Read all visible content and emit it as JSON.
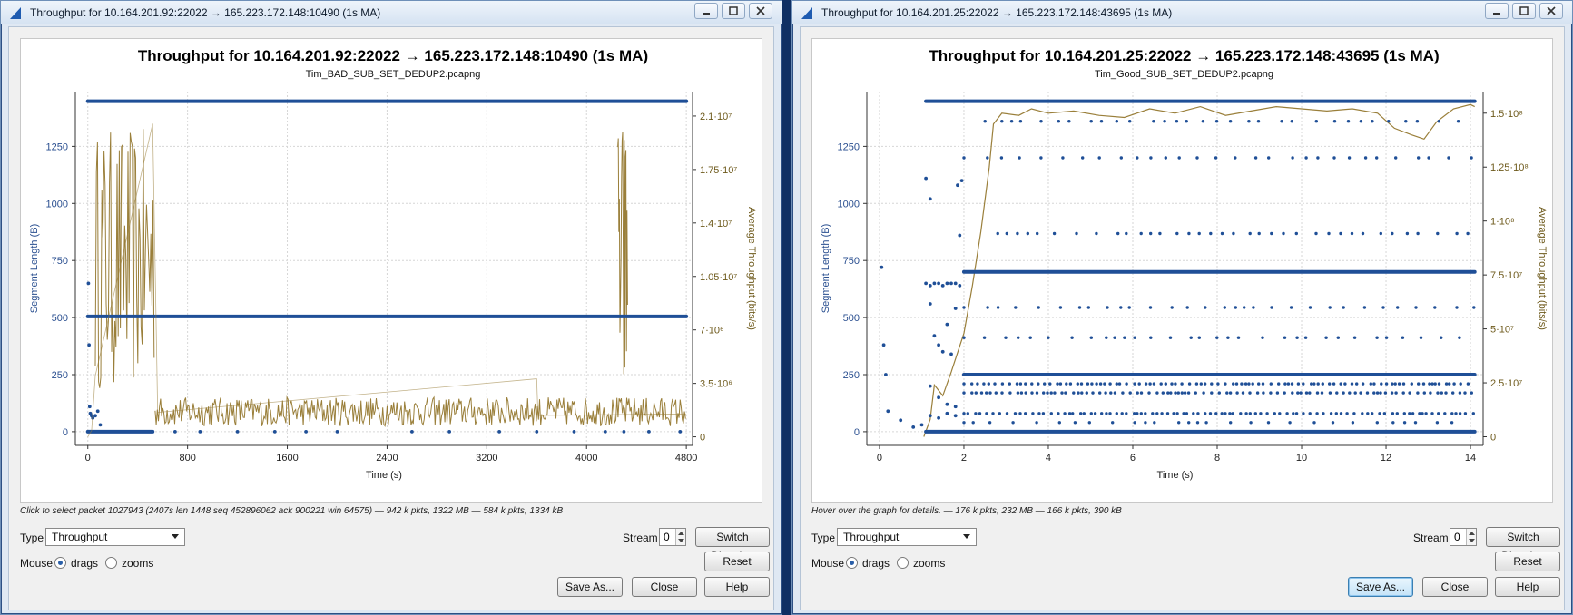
{
  "colors": {
    "segment": "#1f4f97",
    "throughput": "#9a7f3a",
    "grid": "#d6d6d6",
    "desktop": "#0f2f63"
  },
  "windows": [
    {
      "title": "Throughput for 10.164.201.92:22022 → 165.223.172.148:10490 (1s MA)",
      "hint": "Click to select packet 1027943 (2407s len 1448 seq 452896062 ack 900221 win 64575) — 942 k pkts, 1322 MB — 584 k pkts, 1334 kB",
      "type_label": "Type",
      "type_value": "Throughput",
      "stream_label": "Stream",
      "stream_value": "0",
      "switch_direction": "Switch Direction",
      "mouse_label": "Mouse",
      "drags": "drags",
      "zooms": "zooms",
      "reset": "Reset",
      "save_as": "Save As...",
      "close": "Close",
      "help": "Help",
      "save_is_default": false
    },
    {
      "title": "Throughput for 10.164.201.25:22022 → 165.223.172.148:43695 (1s MA)",
      "hint": "Hover over the graph for details. — 176 k pkts, 232 MB — 166 k pkts, 390 kB",
      "type_label": "Type",
      "type_value": "Throughput",
      "stream_label": "Stream",
      "stream_value": "0",
      "switch_direction": "Switch Direction",
      "mouse_label": "Mouse",
      "drags": "drags",
      "zooms": "zooms",
      "reset": "Reset",
      "save_as": "Save As...",
      "close": "Close",
      "help": "Help",
      "save_is_default": true
    }
  ],
  "chart_data": [
    {
      "type": "scatter",
      "title": "Throughput for 10.164.201.92:22022 → 165.223.172.148:10490 (1s MA)",
      "subtitle": "Tim_BAD_SUB_SET_DEDUP2.pcapng",
      "xlabel": "Time (s)",
      "ylabel": "Segment Length (B)",
      "y2label": "Average Throughput (bits/s)",
      "xlim": [
        -100,
        4850
      ],
      "ylim": [
        -60,
        1490
      ],
      "y2lim": [
        -560000,
        22600000
      ],
      "xticks": [
        0,
        800,
        1600,
        2400,
        3200,
        4000,
        4800
      ],
      "xtick_labels": [
        "0",
        "800",
        "1600",
        "2400",
        "3200",
        "4000",
        "4800"
      ],
      "yticks": [
        0,
        250,
        500,
        750,
        1000,
        1250
      ],
      "ytick_labels": [
        "0",
        "250",
        "500",
        "750",
        "1000",
        "1250"
      ],
      "y2ticks": [
        0,
        3500000,
        7000000,
        10500000,
        14000000,
        17500000,
        21000000
      ],
      "y2tick_labels": [
        "0",
        "3.5·10⁶",
        "7·10⁶",
        "1.05·10⁷",
        "1.4·10⁷",
        "1.75·10⁷",
        "2.1·10⁷"
      ],
      "grid": true,
      "series": [
        {
          "name": "Segment Length",
          "axis": "left",
          "style": "points",
          "bands": [
            {
              "y": 1448,
              "x0": 0,
              "x1": 4800
            },
            {
              "y": 505,
              "x0": 0,
              "x1": 4800
            },
            {
              "y": 0,
              "x0": 0,
              "x1": 520
            }
          ],
          "points": [
            [
              5,
              650
            ],
            [
              10,
              380
            ],
            [
              15,
              110
            ],
            [
              20,
              80
            ],
            [
              30,
              70
            ],
            [
              40,
              60
            ],
            [
              60,
              70
            ],
            [
              80,
              90
            ],
            [
              100,
              30
            ],
            [
              700,
              0
            ],
            [
              900,
              0
            ],
            [
              1200,
              0
            ],
            [
              1500,
              0
            ],
            [
              1750,
              0
            ],
            [
              2000,
              0
            ],
            [
              2407,
              1448
            ],
            [
              2600,
              0
            ],
            [
              2900,
              0
            ],
            [
              3300,
              0
            ],
            [
              3600,
              0
            ],
            [
              3900,
              0
            ],
            [
              4150,
              0
            ],
            [
              4300,
              0
            ],
            [
              4500,
              0
            ],
            [
              4750,
              0
            ]
          ]
        },
        {
          "name": "Throughput",
          "axis": "right",
          "style": "line",
          "segments": [
            {
              "x0": 60,
              "x1": 540,
              "low": 3000000,
              "high": 20200000,
              "noise": "dense"
            },
            {
              "x0": 540,
              "x1": 4800,
              "low": 700000,
              "high": 2600000,
              "noise": "dense"
            },
            {
              "x0": 4250,
              "x1": 4330,
              "low": 800000,
              "high": 21000000,
              "noise": "spike"
            }
          ],
          "points": [
            [
              0,
              0
            ],
            [
              30,
              400000
            ],
            [
              60,
              4000000
            ],
            [
              520,
              20500000
            ],
            [
              560,
              1600000
            ],
            [
              3600,
              3800000
            ],
            [
              3610,
              1400000
            ],
            [
              4800,
              1500000
            ]
          ]
        }
      ]
    },
    {
      "type": "scatter",
      "title": "Throughput for 10.164.201.25:22022 → 165.223.172.148:43695 (1s MA)",
      "subtitle": "Tim_Good_SUB_SET_DEDUP2.pcapng",
      "xlabel": "Time (s)",
      "ylabel": "Segment Length (B)",
      "y2label": "Average Throughput (bits/s)",
      "xlim": [
        -0.3,
        14.3
      ],
      "ylim": [
        -60,
        1490
      ],
      "y2lim": [
        -4000000,
        160000000
      ],
      "xticks": [
        0,
        2,
        4,
        6,
        8,
        10,
        12,
        14
      ],
      "xtick_labels": [
        "0",
        "2",
        "4",
        "6",
        "8",
        "10",
        "12",
        "14"
      ],
      "yticks": [
        0,
        250,
        500,
        750,
        1000,
        1250
      ],
      "ytick_labels": [
        "0",
        "250",
        "500",
        "750",
        "1000",
        "1250"
      ],
      "y2ticks": [
        0,
        25000000,
        50000000,
        75000000,
        100000000,
        125000000,
        150000000
      ],
      "y2tick_labels": [
        "0",
        "2.5·10⁷",
        "5·10⁷",
        "7.5·10⁷",
        "1·10⁸",
        "1.25·10⁸",
        "1.5·10⁸"
      ],
      "grid": true,
      "series": [
        {
          "name": "Segment Length",
          "axis": "left",
          "style": "points",
          "bands": [
            {
              "y": 1448,
              "x0": 1.1,
              "x1": 14.1,
              "density": "dense"
            },
            {
              "y": 1360,
              "x0": 2.5,
              "x1": 14.1,
              "density": "sparse"
            },
            {
              "y": 1200,
              "x0": 2.0,
              "x1": 14.1,
              "density": "sparse"
            },
            {
              "y": 868,
              "x0": 2.8,
              "x1": 14.1,
              "density": "sparse"
            },
            {
              "y": 700,
              "x0": 2.0,
              "x1": 14.1,
              "density": "dense"
            },
            {
              "y": 544,
              "x0": 2.0,
              "x1": 14.1,
              "density": "sparse"
            },
            {
              "y": 412,
              "x0": 2.0,
              "x1": 14.1,
              "density": "sparse"
            },
            {
              "y": 250,
              "x0": 2.0,
              "x1": 14.1,
              "density": "dense"
            },
            {
              "y": 210,
              "x0": 2.0,
              "x1": 14.1,
              "density": "medium"
            },
            {
              "y": 170,
              "x0": 2.0,
              "x1": 14.1,
              "density": "medium"
            },
            {
              "y": 80,
              "x0": 2.0,
              "x1": 14.1,
              "density": "medium"
            },
            {
              "y": 40,
              "x0": 2.0,
              "x1": 14.1,
              "density": "sparse"
            },
            {
              "y": 0,
              "x0": 1.1,
              "x1": 14.1,
              "density": "dense"
            }
          ],
          "points": [
            [
              0.05,
              720
            ],
            [
              0.1,
              380
            ],
            [
              0.15,
              250
            ],
            [
              0.2,
              90
            ],
            [
              0.5,
              50
            ],
            [
              0.8,
              20
            ],
            [
              1.0,
              30
            ],
            [
              1.1,
              1110
            ],
            [
              1.2,
              1020
            ],
            [
              1.1,
              650
            ],
            [
              1.2,
              640
            ],
            [
              1.3,
              650
            ],
            [
              1.4,
              650
            ],
            [
              1.5,
              640
            ],
            [
              1.6,
              650
            ],
            [
              1.7,
              650
            ],
            [
              1.8,
              650
            ],
            [
              1.9,
              640
            ],
            [
              1.2,
              560
            ],
            [
              1.3,
              420
            ],
            [
              1.4,
              380
            ],
            [
              1.5,
              350
            ],
            [
              1.6,
              470
            ],
            [
              1.7,
              340
            ],
            [
              1.8,
              540
            ],
            [
              1.2,
              200
            ],
            [
              1.4,
              150
            ],
            [
              1.6,
              120
            ],
            [
              1.8,
              110
            ],
            [
              1.2,
              70
            ],
            [
              1.4,
              60
            ],
            [
              1.6,
              80
            ],
            [
              1.8,
              70
            ],
            [
              1.9,
              860
            ],
            [
              1.95,
              1100
            ],
            [
              1.85,
              1080
            ]
          ]
        },
        {
          "name": "Throughput",
          "axis": "right",
          "style": "line",
          "points": [
            [
              1.05,
              0
            ],
            [
              1.2,
              8000000
            ],
            [
              1.3,
              24000000
            ],
            [
              1.5,
              19000000
            ],
            [
              1.7,
              30000000
            ],
            [
              2.0,
              48000000
            ],
            [
              2.2,
              70000000
            ],
            [
              2.4,
              95000000
            ],
            [
              2.6,
              125000000
            ],
            [
              2.7,
              145000000
            ],
            [
              2.9,
              150000000
            ],
            [
              3.3,
              149000000
            ],
            [
              3.6,
              152000000
            ],
            [
              4.0,
              150000000
            ],
            [
              4.6,
              151000000
            ],
            [
              5.2,
              149000000
            ],
            [
              5.8,
              148000000
            ],
            [
              6.4,
              152000000
            ],
            [
              7.0,
              150000000
            ],
            [
              7.6,
              153000000
            ],
            [
              8.2,
              149000000
            ],
            [
              8.8,
              151000000
            ],
            [
              9.4,
              153000000
            ],
            [
              10.0,
              152000000
            ],
            [
              10.6,
              151000000
            ],
            [
              11.2,
              152000000
            ],
            [
              11.8,
              150000000
            ],
            [
              12.2,
              143000000
            ],
            [
              12.6,
              140000000
            ],
            [
              12.9,
              138000000
            ],
            [
              13.2,
              146000000
            ],
            [
              13.6,
              152000000
            ],
            [
              14.0,
              154000000
            ],
            [
              14.1,
              153000000
            ]
          ]
        }
      ]
    }
  ]
}
